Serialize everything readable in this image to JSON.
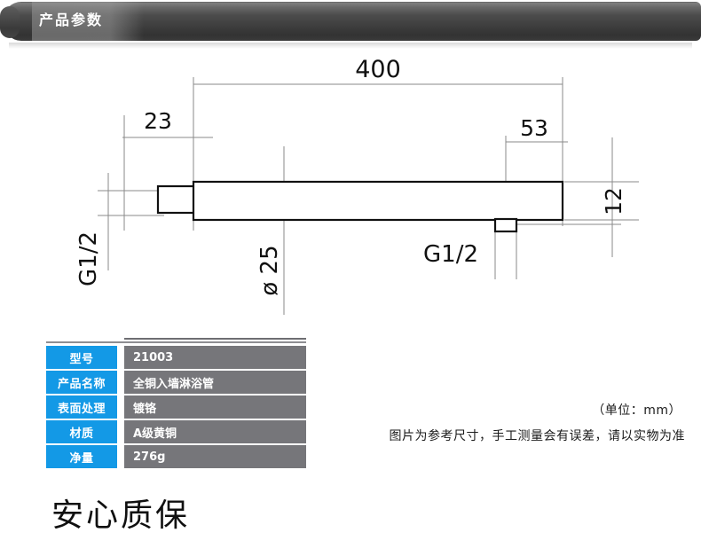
{
  "header": {
    "title": "产品参数"
  },
  "drawing": {
    "dimensions": {
      "overall_length": "400",
      "left_thread_length": "23",
      "outlet_offset": "53",
      "body_height": "12",
      "diameter": "ø 25",
      "inlet_thread": "G1/2",
      "outlet_thread": "G1/2"
    }
  },
  "spec_table": {
    "rows": [
      {
        "label": "型号",
        "value": "21003"
      },
      {
        "label": "产品名称",
        "value": "全铜入墙淋浴管"
      },
      {
        "label": "表面处理",
        "value": "镀铬"
      },
      {
        "label": "材质",
        "value": "A级黄铜"
      },
      {
        "label": "净量",
        "value": "276g"
      }
    ]
  },
  "notes": {
    "unit": "（单位：mm）",
    "disclaimer": "图片为参考尺寸，手工测量会有误差，请以实物为准"
  },
  "footer": {
    "slogan": "安心质保"
  },
  "colors": {
    "label_blue": "#1399e6",
    "value_gray": "#76767a",
    "bar_dark": "#3e3e3e",
    "line": "#8a8a8a",
    "outline": "#111111"
  }
}
